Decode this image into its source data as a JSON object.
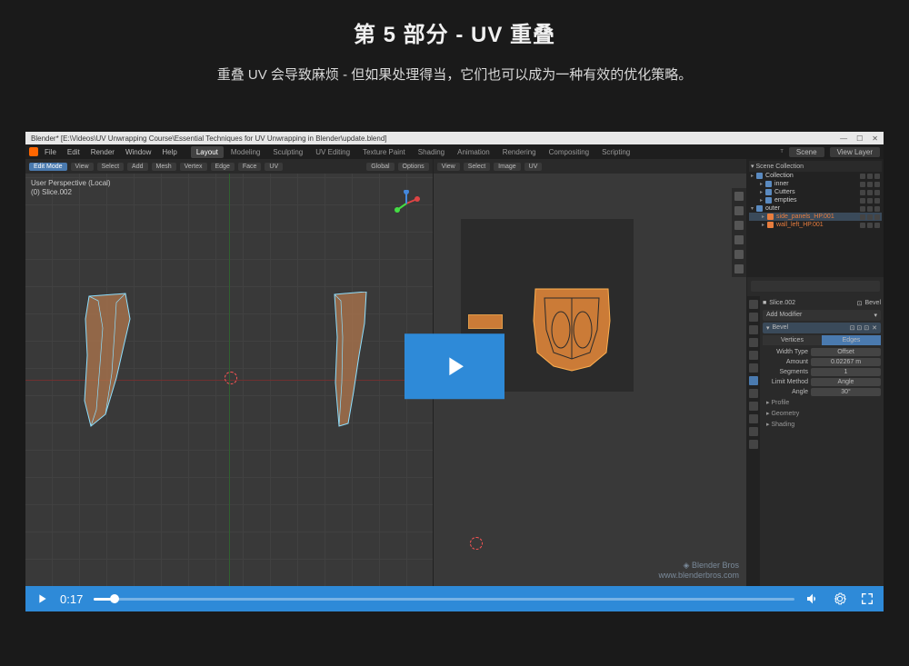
{
  "header": {
    "title": "第 5 部分 - UV 重叠",
    "subtitle": "重叠 UV 会导致麻烦 - 但如果处理得当，它们也可以成为一种有效的优化策略。"
  },
  "app": {
    "titlebar": "Blender* [E:\\Videos\\UV Unwrapping Course\\Essential Techniques for UV Unwrapping in Blender\\update.blend]",
    "menus": [
      "File",
      "Edit",
      "Render",
      "Window",
      "Help"
    ],
    "workspace_tabs": [
      "Layout",
      "Modeling",
      "Sculpting",
      "UV Editing",
      "Texture Paint",
      "Shading",
      "Animation",
      "Rendering",
      "Compositing",
      "Scripting"
    ],
    "active_workspace": "Layout",
    "scene": "Scene",
    "view_layer": "View Layer"
  },
  "viewport3d": {
    "mode": "Edit Mode",
    "header_menus": [
      "View",
      "Select",
      "Add",
      "Mesh",
      "Vertex",
      "Edge",
      "Face",
      "UV"
    ],
    "orientation": "Global",
    "options": "Options",
    "overlay_line1": "User Perspective (Local)",
    "overlay_line2": "(0) Slice.002"
  },
  "uv_editor": {
    "header_menus": [
      "View",
      "Select",
      "Image",
      "UV"
    ]
  },
  "outliner": {
    "title": "Scene Collection",
    "items": [
      {
        "label": "Collection",
        "indent": 1
      },
      {
        "label": "inner",
        "indent": 2
      },
      {
        "label": "Cutters",
        "indent": 2
      },
      {
        "label": "empties",
        "indent": 2
      },
      {
        "label": "outer",
        "indent": 1
      },
      {
        "label": "side_panels_HP.001",
        "indent": 2,
        "orange": true
      },
      {
        "label": "wall_left_HP.001",
        "indent": 2,
        "orange": true
      }
    ]
  },
  "properties": {
    "object_name": "Slice.002",
    "modifier_label": "Bevel",
    "add_modifier": "Add Modifier",
    "bevel_panel": "Bevel",
    "mode_vertices": "Vertices",
    "mode_edges": "Edges",
    "width_type_label": "Width Type",
    "width_type_value": "Offset",
    "amount_label": "Amount",
    "amount_value": "0.02267 m",
    "segments_label": "Segments",
    "segments_value": "1",
    "limit_method_label": "Limit Method",
    "limit_method_value": "Angle",
    "angle_label": "Angle",
    "angle_value": "30°",
    "collapse_profile": "Profile",
    "collapse_geometry": "Geometry",
    "collapse_shading": "Shading"
  },
  "watermark": {
    "line1": "Blender Bros",
    "line2": "www.blenderbros.com"
  },
  "player": {
    "time": "0:17"
  }
}
